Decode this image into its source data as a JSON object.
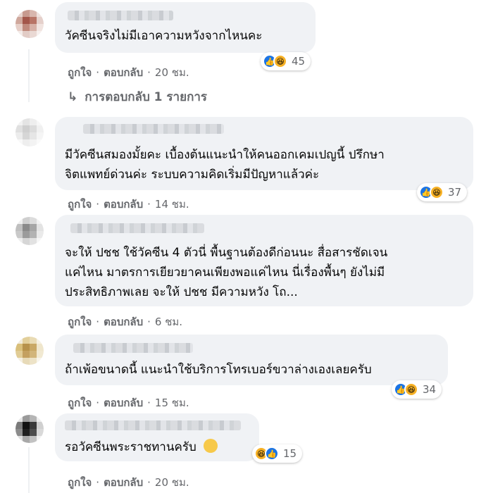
{
  "actions": {
    "like_label": "ถูกใจ",
    "separator": "·",
    "reply_label": "ตอบกลับ"
  },
  "view_replies": {
    "arrow": "↳",
    "label": "การตอบกลับ 1 รายการ"
  },
  "comments": [
    {
      "lines": [
        "วัคซีนจริงไม่มีเอาความหวังจากไหนคะ"
      ],
      "reactions": [
        "like",
        "haha"
      ],
      "reaction_count": "45",
      "time": "20 ชม."
    },
    {
      "lines": [
        "มีวัคซีนสมองมั้ยคะ เบื้องต้นแนะนำให้คนออกเคมเปญนี้ ปรึกษา",
        "จิตแพทย์ด่วนค่ะ ระบบความคิดเริ่มมีปัญหาแล้วค่ะ"
      ],
      "reactions": [
        "like",
        "haha"
      ],
      "reaction_count": "37",
      "time": "14 ชม."
    },
    {
      "lines": [
        "จะให้ ปชช ใช้วัคซีน 4 ตัวนี่ พื้นฐานต้องดีก่อนนะ สื่อสารชัดเจน",
        "แค่ไหน มาตรการเยียวยาคนเพียงพอแค่ไหน นี่เรื่องพื้นๆ ยังไม่มี",
        "ประสิทธิภาพเลย จะให้ ปชช มีความหวัง โถ..."
      ],
      "reactions": [],
      "reaction_count": "",
      "time": "6 ชม."
    },
    {
      "lines": [
        "ถ้าเพ้อขนาดนี้ แนะนำใช้บริการโทรเบอร์ขวาล่างเองเลยครับ"
      ],
      "reactions": [
        "like",
        "haha"
      ],
      "reaction_count": "34",
      "time": "15 ชม."
    },
    {
      "lines": [
        "รอวัคซีนพระราชทานครับ"
      ],
      "inline_emoji": "smirk-emoji",
      "reactions": [
        "haha",
        "like"
      ],
      "reaction_count": "15",
      "time": "20 ชม."
    }
  ],
  "colors": {
    "bubble": "#f0f2f5",
    "like": "#1b74e4",
    "haha": "#f7b125",
    "meta_text": "#65676b"
  }
}
